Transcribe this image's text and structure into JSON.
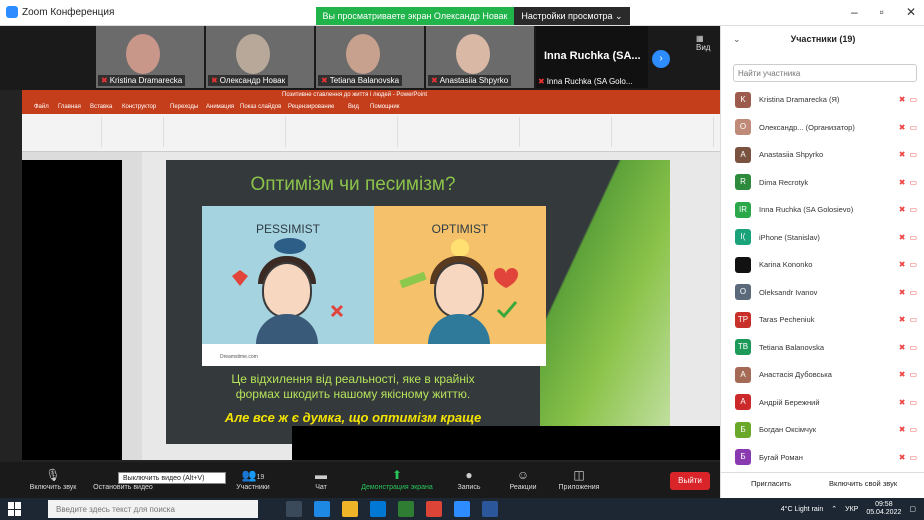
{
  "titlebar": {
    "app_title": "Zoom Конференция",
    "share_banner": "Вы просматриваете экран Олександр Новак",
    "view_options": "Настройки просмотра ⌄",
    "minimize": "–",
    "maximize": "▫",
    "close": "✕"
  },
  "videos": [
    {
      "name": "Kristina Dramarecka",
      "face": "#c9968a"
    },
    {
      "name": "Олександр Новак",
      "face": "#b8a89a"
    },
    {
      "name": "Tetiana Balanovska",
      "face": "#c7a18d"
    },
    {
      "name": "Anastasiia Shpyrko",
      "face": "#d9b8a5"
    }
  ],
  "name_tile": {
    "big": "Inna Ruchka (SA...",
    "label": "Inna Ruchka (SA Golo..."
  },
  "view_btn": "Вид",
  "ppt": {
    "title": "Позитивне ставлення до життя і людей - PowerPoint",
    "tabs": [
      "Файл",
      "Главная",
      "Вставка",
      "Конструктор",
      "Переходы",
      "Анимация",
      "Показ слайдов",
      "Рецензирование",
      "Вид",
      "Помощник"
    ]
  },
  "slide": {
    "heading": "Оптимізм чи песимізм?",
    "pessimist": "PESSIMIST",
    "optimist": "OPTIMIST",
    "footer_site": "Dreamstime.com",
    "text1_line1": "Це відхилення від реальності, яке в крайніх",
    "text1_line2": "формах шкодить нашому якісному життю.",
    "text2": "Але все ж є думка, що оптимізм краще"
  },
  "participants": {
    "title": "Участники (19)",
    "search_placeholder": "Найти участника",
    "items": [
      {
        "name": "Kristina Dramarecka (Я)",
        "avatar": "K",
        "color": "#9c5b4c"
      },
      {
        "name": "Олександр... (Организатор)",
        "avatar": "О",
        "color": "#c08a78"
      },
      {
        "name": "Anastasiia Shpyrko",
        "avatar": "A",
        "color": "#7a5240"
      },
      {
        "name": "Dima Recrotyk",
        "avatar": "R",
        "color": "#2e8b3e"
      },
      {
        "name": "Inna Ruchka (SA Golosievo)",
        "avatar": "IR",
        "color": "#2aa84a"
      },
      {
        "name": "iPhone (Stanislav)",
        "avatar": "I(",
        "color": "#1aa37a"
      },
      {
        "name": "Karina Kononko",
        "avatar": "",
        "color": "#111111"
      },
      {
        "name": "Oleksandr Ivanov",
        "avatar": "O",
        "color": "#5a6a7a"
      },
      {
        "name": "Taras Pecheniuk",
        "avatar": "TP",
        "color": "#c8312a"
      },
      {
        "name": "Tetiana Balanovska",
        "avatar": "TB",
        "color": "#1d9a5a"
      },
      {
        "name": "Анастасія Дубовська",
        "avatar": "А",
        "color": "#a56a55"
      },
      {
        "name": "Андрій Бережний",
        "avatar": "А",
        "color": "#cc2a2a"
      },
      {
        "name": "Богдан Оксімчук",
        "avatar": "Б",
        "color": "#6aa82a"
      },
      {
        "name": "Бугай Роман",
        "avatar": "Б",
        "color": "#8a3ab0"
      }
    ],
    "invite": "Пригласить",
    "unmute_self": "Включить свой звук"
  },
  "toolbar": {
    "unmute": "Включить звук",
    "stop_video": "Остановить видео",
    "participants": "Участники",
    "participants_count": "19",
    "chat": "Чат",
    "share": "Демонстрация экрана",
    "record": "Запись",
    "reactions": "Реакции",
    "apps": "Приложения",
    "leave": "Выйти",
    "tooltip": "Выключить видео (Alt+V)"
  },
  "taskbar": {
    "search_placeholder": "Введите здесь текст для поиска",
    "weather": "4°C Light rain",
    "lang": "УКР",
    "time": "09:58",
    "date": "05.04.2022"
  }
}
